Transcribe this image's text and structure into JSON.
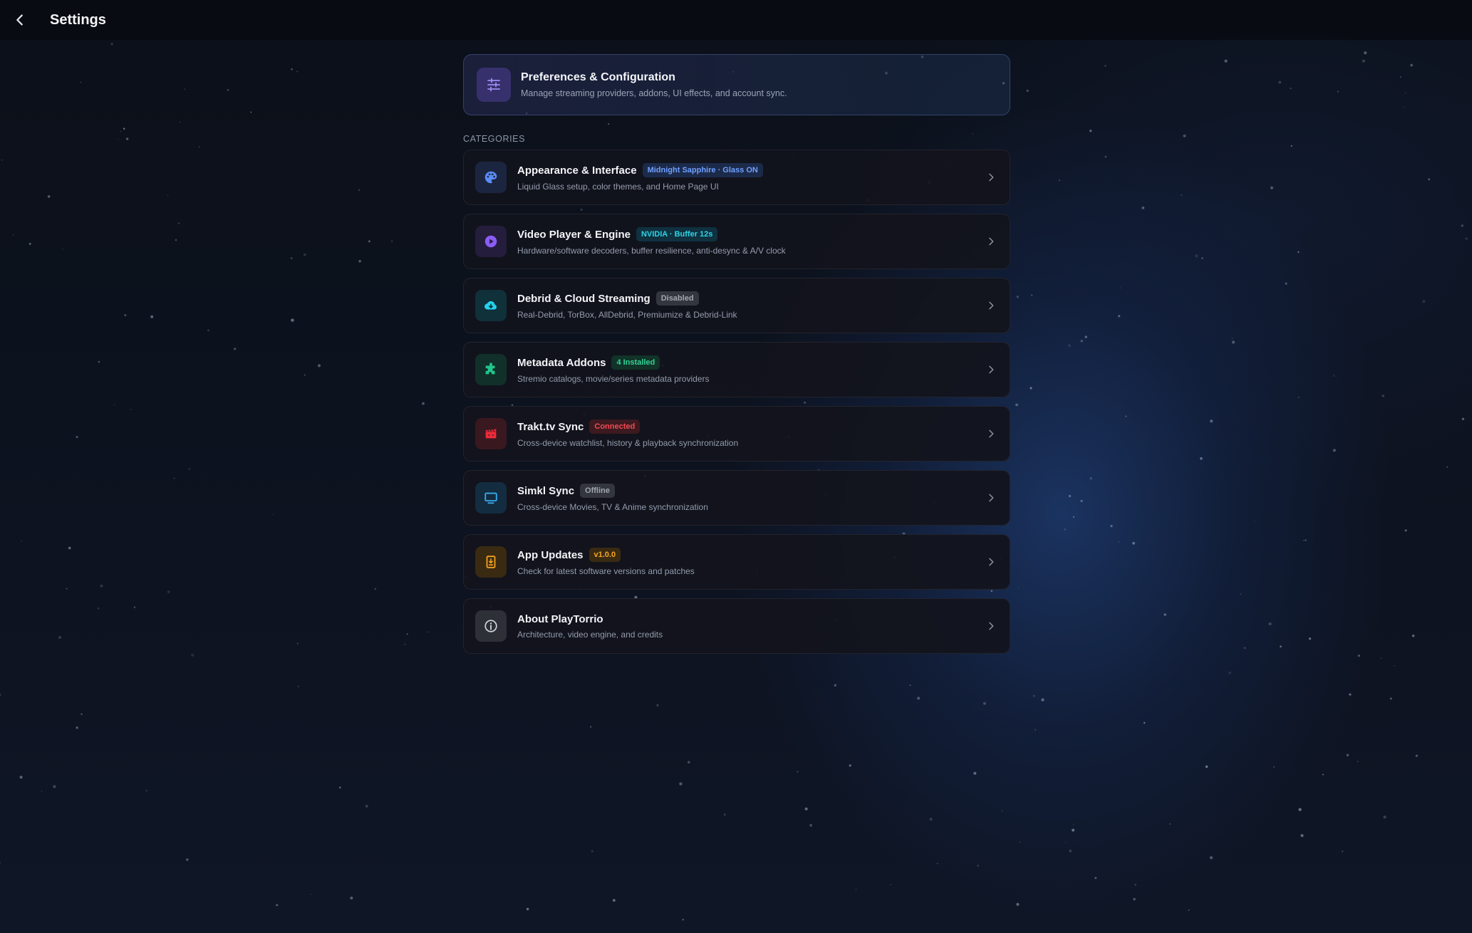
{
  "header": {
    "title": "Settings",
    "back_icon": "chevron-left-icon"
  },
  "hero": {
    "title": "Preferences & Configuration",
    "subtitle": "Manage streaming providers, addons, UI effects, and account sync.",
    "icon": "sliders-icon"
  },
  "section_label": "CATEGORIES",
  "categories": [
    {
      "name": "appearance",
      "title": "Appearance & Interface",
      "badge": "Midnight Sapphire · Glass ON",
      "description": "Liquid Glass setup, color themes, and Home Page UI",
      "icon": "palette-icon",
      "icon_color": "#5b8cf5",
      "icon_bg": "#1c2540",
      "badge_color": "#6fa0ff",
      "badge_bg": "#1c2a4a"
    },
    {
      "name": "video-player",
      "title": "Video Player & Engine",
      "badge": "NVIDIA · Buffer 12s",
      "description": "Hardware/software decoders, buffer resilience, anti-desync & A/V clock",
      "icon": "play-circle-icon",
      "icon_color": "#8b5cf6",
      "icon_bg": "#241d3c",
      "badge_color": "#2dd4e6",
      "badge_bg": "#0f3140"
    },
    {
      "name": "debrid",
      "title": "Debrid & Cloud Streaming",
      "badge": "Disabled",
      "description": "Real-Debrid, TorBox, AllDebrid, Premiumize & Debrid-Link",
      "icon": "cloud-download-icon",
      "icon_color": "#22d3ee",
      "icon_bg": "#10303a",
      "badge_color": "#a0a6b2",
      "badge_bg": "#33363e"
    },
    {
      "name": "metadata-addons",
      "title": "Metadata Addons",
      "badge": "4 Installed",
      "description": "Stremio catalogs, movie/series metadata providers",
      "icon": "puzzle-icon",
      "icon_color": "#22c58b",
      "icon_bg": "#11302a",
      "badge_color": "#34d399",
      "badge_bg": "#113328"
    },
    {
      "name": "trakt",
      "title": "Trakt.tv Sync",
      "badge": "Connected",
      "description": "Cross-device watchlist, history & playback synchronization",
      "icon": "clapperboard-icon",
      "icon_color": "#ef2b3a",
      "icon_bg": "#3a1820",
      "badge_color": "#f04a55",
      "badge_bg": "#3d1a20"
    },
    {
      "name": "simkl",
      "title": "Simkl Sync",
      "badge": "Offline",
      "description": "Cross-device Movies, TV & Anime synchronization",
      "icon": "monitor-icon",
      "icon_color": "#38a9f0",
      "icon_bg": "#132c40",
      "badge_color": "#a0a6b2",
      "badge_bg": "#33363e"
    },
    {
      "name": "app-updates",
      "title": "App Updates",
      "badge": "v1.0.0",
      "description": "Check for latest software versions and patches",
      "icon": "download-box-icon",
      "icon_color": "#f0a020",
      "icon_bg": "#3a2a12",
      "badge_color": "#f5a524",
      "badge_bg": "#3a2a12"
    },
    {
      "name": "about",
      "title": "About PlayTorrio",
      "badge": "",
      "description": "Architecture, video engine, and credits",
      "icon": "info-circle-icon",
      "icon_color": "#d4d7de",
      "icon_bg": "#2e3038",
      "badge_color": "",
      "badge_bg": ""
    }
  ]
}
